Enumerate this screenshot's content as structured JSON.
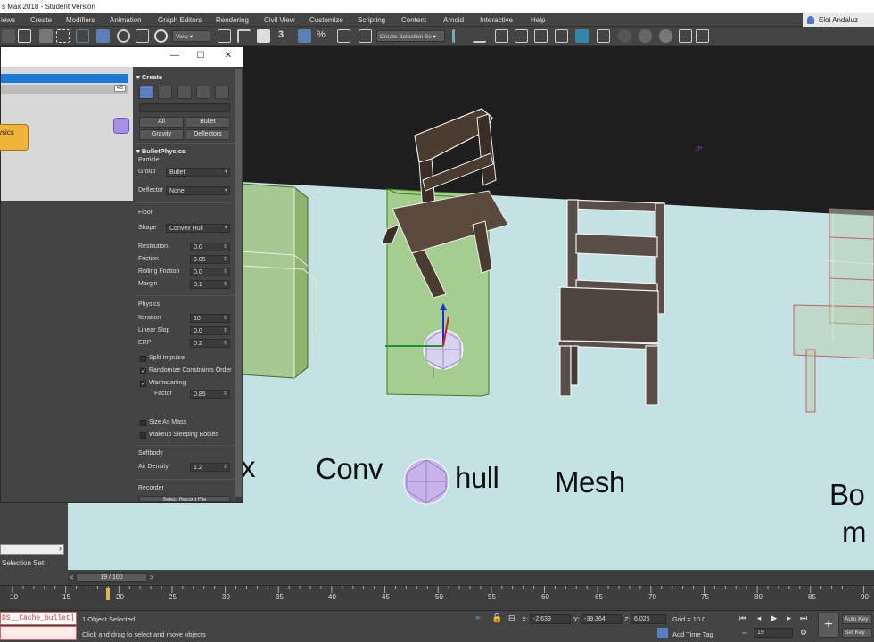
{
  "app": {
    "title": "s Max 2018 - Student Version",
    "user": "Eloi Andaluz"
  },
  "menu": [
    "iews",
    "Create",
    "Modifiers",
    "Animation",
    "Graph Editors",
    "Rendering",
    "Civil View",
    "Customize",
    "Scripting",
    "Content",
    "Arnold",
    "Interactive",
    "Help"
  ],
  "toolbar": {
    "view_dropdown": "View",
    "selection_set_dropdown": "Create Selection Se"
  },
  "dialog": {
    "node_label": "ysics",
    "grey_tag": "4B",
    "minimize": "—",
    "maximize": "☐",
    "close": "✕"
  },
  "command_panel": {
    "create_header": "Create",
    "buttons": {
      "all": "All",
      "bullet": "Bullet",
      "gravity": "Gravity",
      "deflectors": "Deflectors"
    },
    "bullet_header": "BulletPhysics",
    "particle_label": "Particle",
    "group_label": "Group",
    "group_value": "Bullet",
    "deflector_label": "Deflector",
    "deflector_value": "None",
    "floor_label": "Floor",
    "shape_label": "Shape",
    "shape_value": "Convex Hull",
    "restitution_label": "Restitution",
    "restitution_value": "0.0",
    "friction_label": "Friction",
    "friction_value": "0.05",
    "rolling_label": "Rolling Friction",
    "rolling_value": "0.0",
    "margin_label": "Margin",
    "margin_value": "0.1",
    "physics_label": "Physics",
    "iteration_label": "Iteration",
    "iteration_value": "10",
    "linear_slop_label": "Linear Slop",
    "linear_slop_value": "0.0",
    "erp_label": "ERP",
    "erp_value": "0.2",
    "split_impulse": "Split Impulse",
    "randomize": "Randomize Constraints Order",
    "warmstarting": "Warmstarting",
    "factor_label": "Factor",
    "factor_value": "0.85",
    "size_as_mass": "Size As Mass",
    "wakeup": "Wakeup Sleeping Bodies",
    "softbody_label": "Softbody",
    "air_density_label": "Air Density",
    "air_density_value": "1.2",
    "recorder_label": "Recorder",
    "select_record_button": "Select Record File"
  },
  "viewport": {
    "labels": {
      "x": "x",
      "conv": "Conv",
      "hull": "hull",
      "mesh": "Mesh",
      "bo": "Bo",
      "m": "m"
    },
    "stray": "JP"
  },
  "left": {
    "selection_set": "Selection Set:",
    "arrow": "›"
  },
  "timeline": {
    "frame": "19 / 100",
    "prev": "<",
    "next": ">",
    "ticks": [
      "10",
      "15",
      "20",
      "25",
      "30",
      "35",
      "40",
      "45",
      "50",
      "55",
      "60",
      "65",
      "70",
      "75",
      "80",
      "85",
      "90"
    ]
  },
  "status": {
    "maxscript": "DS__Cache_bullet]",
    "selected": "1 Object Selected",
    "prompt": "Click and drag to select and move objects",
    "x_label": "X:",
    "x_value": "-2.639",
    "y_label": "Y:",
    "y_value": "-39.364",
    "z_label": "Z:",
    "z_value": "6.025",
    "grid": "Grid = 10.0",
    "add_time_tag": "Add Time Tag",
    "frame_field": "19",
    "auto_key": "Auto Key",
    "set_key": "Set Key"
  }
}
